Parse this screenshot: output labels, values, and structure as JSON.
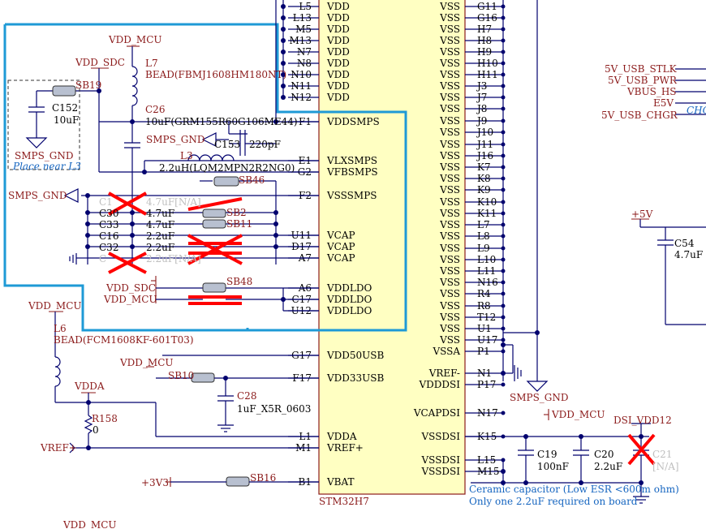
{
  "chip": {
    "name": "STM32H7",
    "left_pins": [
      {
        "num": "L5",
        "name": "VDD"
      },
      {
        "num": "L13",
        "name": "VDD"
      },
      {
        "num": "M5",
        "name": "VDD"
      },
      {
        "num": "M13",
        "name": "VDD"
      },
      {
        "num": "N7",
        "name": "VDD"
      },
      {
        "num": "N8",
        "name": "VDD"
      },
      {
        "num": "N10",
        "name": "VDD"
      },
      {
        "num": "N11",
        "name": "VDD"
      },
      {
        "num": "N12",
        "name": "VDD"
      },
      {
        "num": "F1",
        "name": "VDDSMPS"
      },
      {
        "num": "E1",
        "name": "VLXSMPS"
      },
      {
        "num": "G2",
        "name": "VFBSMPS"
      },
      {
        "num": "F2",
        "name": "VSSSMPS"
      },
      {
        "num": "U11",
        "name": "VCAP"
      },
      {
        "num": "D17",
        "name": "VCAP"
      },
      {
        "num": "A7",
        "name": "VCAP"
      },
      {
        "num": "A6",
        "name": "VDDLDO"
      },
      {
        "num": "C17",
        "name": "VDDLDO"
      },
      {
        "num": "U12",
        "name": "VDDLDO"
      },
      {
        "num": "G17",
        "name": "VDD50USB"
      },
      {
        "num": "F17",
        "name": "VDD33USB"
      },
      {
        "num": "L1",
        "name": "VDDA"
      },
      {
        "num": "M1",
        "name": "VREF+"
      },
      {
        "num": "B1",
        "name": "VBAT"
      }
    ],
    "right_pins": [
      {
        "num": "G11",
        "name": "VSS"
      },
      {
        "num": "G16",
        "name": "VSS"
      },
      {
        "num": "H7",
        "name": "VSS"
      },
      {
        "num": "H8",
        "name": "VSS"
      },
      {
        "num": "H9",
        "name": "VSS"
      },
      {
        "num": "H10",
        "name": "VSS"
      },
      {
        "num": "H11",
        "name": "VSS"
      },
      {
        "num": "J3",
        "name": "VSS"
      },
      {
        "num": "J7",
        "name": "VSS"
      },
      {
        "num": "J8",
        "name": "VSS"
      },
      {
        "num": "J9",
        "name": "VSS"
      },
      {
        "num": "J10",
        "name": "VSS"
      },
      {
        "num": "J11",
        "name": "VSS"
      },
      {
        "num": "J16",
        "name": "VSS"
      },
      {
        "num": "K7",
        "name": "VSS"
      },
      {
        "num": "K8",
        "name": "VSS"
      },
      {
        "num": "K9",
        "name": "VSS"
      },
      {
        "num": "K10",
        "name": "VSS"
      },
      {
        "num": "K11",
        "name": "VSS"
      },
      {
        "num": "L7",
        "name": "VSS"
      },
      {
        "num": "L8",
        "name": "VSS"
      },
      {
        "num": "L9",
        "name": "VSS"
      },
      {
        "num": "L10",
        "name": "VSS"
      },
      {
        "num": "L11",
        "name": "VSS"
      },
      {
        "num": "N16",
        "name": "VSS"
      },
      {
        "num": "R4",
        "name": "VSS"
      },
      {
        "num": "R8",
        "name": "VSS"
      },
      {
        "num": "T12",
        "name": "VSS"
      },
      {
        "num": "U1",
        "name": "VSS"
      },
      {
        "num": "U17",
        "name": "VSS"
      },
      {
        "num": "P1",
        "name": "VSSA"
      },
      {
        "num": "N1",
        "name": "VREF-"
      },
      {
        "num": "P17",
        "name": "VDDDSI"
      },
      {
        "num": "N17",
        "name": "VCAPDSI"
      },
      {
        "num": "K15",
        "name": "VSSDSI"
      },
      {
        "num": "L15",
        "name": "VSSDSI"
      },
      {
        "num": "M15",
        "name": "VSSDSI"
      }
    ]
  },
  "nets": {
    "vdd_mcu": "VDD_MCU",
    "vdd_sdc": "VDD_SDC",
    "smps_gnd": "SMPS_GND",
    "vdda": "VDDA",
    "vref_plus": "VREF+",
    "plus_5v": "+5V",
    "plus_3v3": "+3V3",
    "dsi_vdd12": "DSI_VDD12",
    "usb_nets": [
      "5V_USB_STLK",
      "5V_USB_PWR",
      "VBUS_HS",
      "E5V",
      "5V_USB_CHGR"
    ],
    "usb_net_partial": "CHG"
  },
  "components": {
    "l7": {
      "ref": "L7",
      "value": "BEAD(FBMJ1608HM180NT)"
    },
    "c26": {
      "ref": "C26",
      "value": "10uF(GRM155R60G106ME44)"
    },
    "c152": {
      "ref": "C152",
      "value": "10uF"
    },
    "c153": {
      "ref": "C153",
      "value": "220pF"
    },
    "l3": {
      "ref": "L3",
      "value": "2.2uH(LQM2MPN2R2NG0)"
    },
    "c_dnp1": {
      "ref": "C1",
      "value": "4.7uF[N/A]"
    },
    "c30": {
      "ref": "C30",
      "value": "4.7uF"
    },
    "c33": {
      "ref": "C33",
      "value": "4.7uF"
    },
    "c16": {
      "ref": "C16",
      "value": "2.2uF"
    },
    "c32": {
      "ref": "C32",
      "value": "2.2uF"
    },
    "c_dnp2": {
      "ref": "C",
      "value": "2.2uF[N/A]"
    },
    "l6": {
      "ref": "L6",
      "value": "BEAD(FCM1608KF-601T03)"
    },
    "c28": {
      "ref": "C28",
      "value": "1uF_X5R_0603"
    },
    "r158": {
      "ref": "R158",
      "value": "0"
    },
    "c19": {
      "ref": "C19",
      "value": "100nF"
    },
    "c20": {
      "ref": "C20",
      "value": "2.2uF"
    },
    "c21": {
      "ref": "C21",
      "value": "[N/A]"
    },
    "c54": {
      "ref": "C54",
      "value": "4.7uF"
    }
  },
  "solder_bridges": [
    "SB19",
    "SB46",
    "SB2",
    "SB11",
    "SB48",
    "SB10",
    "SB16"
  ],
  "notes": {
    "place_near": "Place near L3",
    "ceramic": "Ceramic capacitor (Low ESR <600m ohm)",
    "only_one": "Only one 2.2uF required on board"
  },
  "colors": {
    "net_label": "#8b1a1a",
    "wire": "#00006e",
    "chip_fill": "#ffffc2",
    "highlight_box": "#1e9ad6",
    "cross": "#ff0000",
    "dnp_text": "#bfbfbf",
    "note_text": "#1565c0"
  }
}
